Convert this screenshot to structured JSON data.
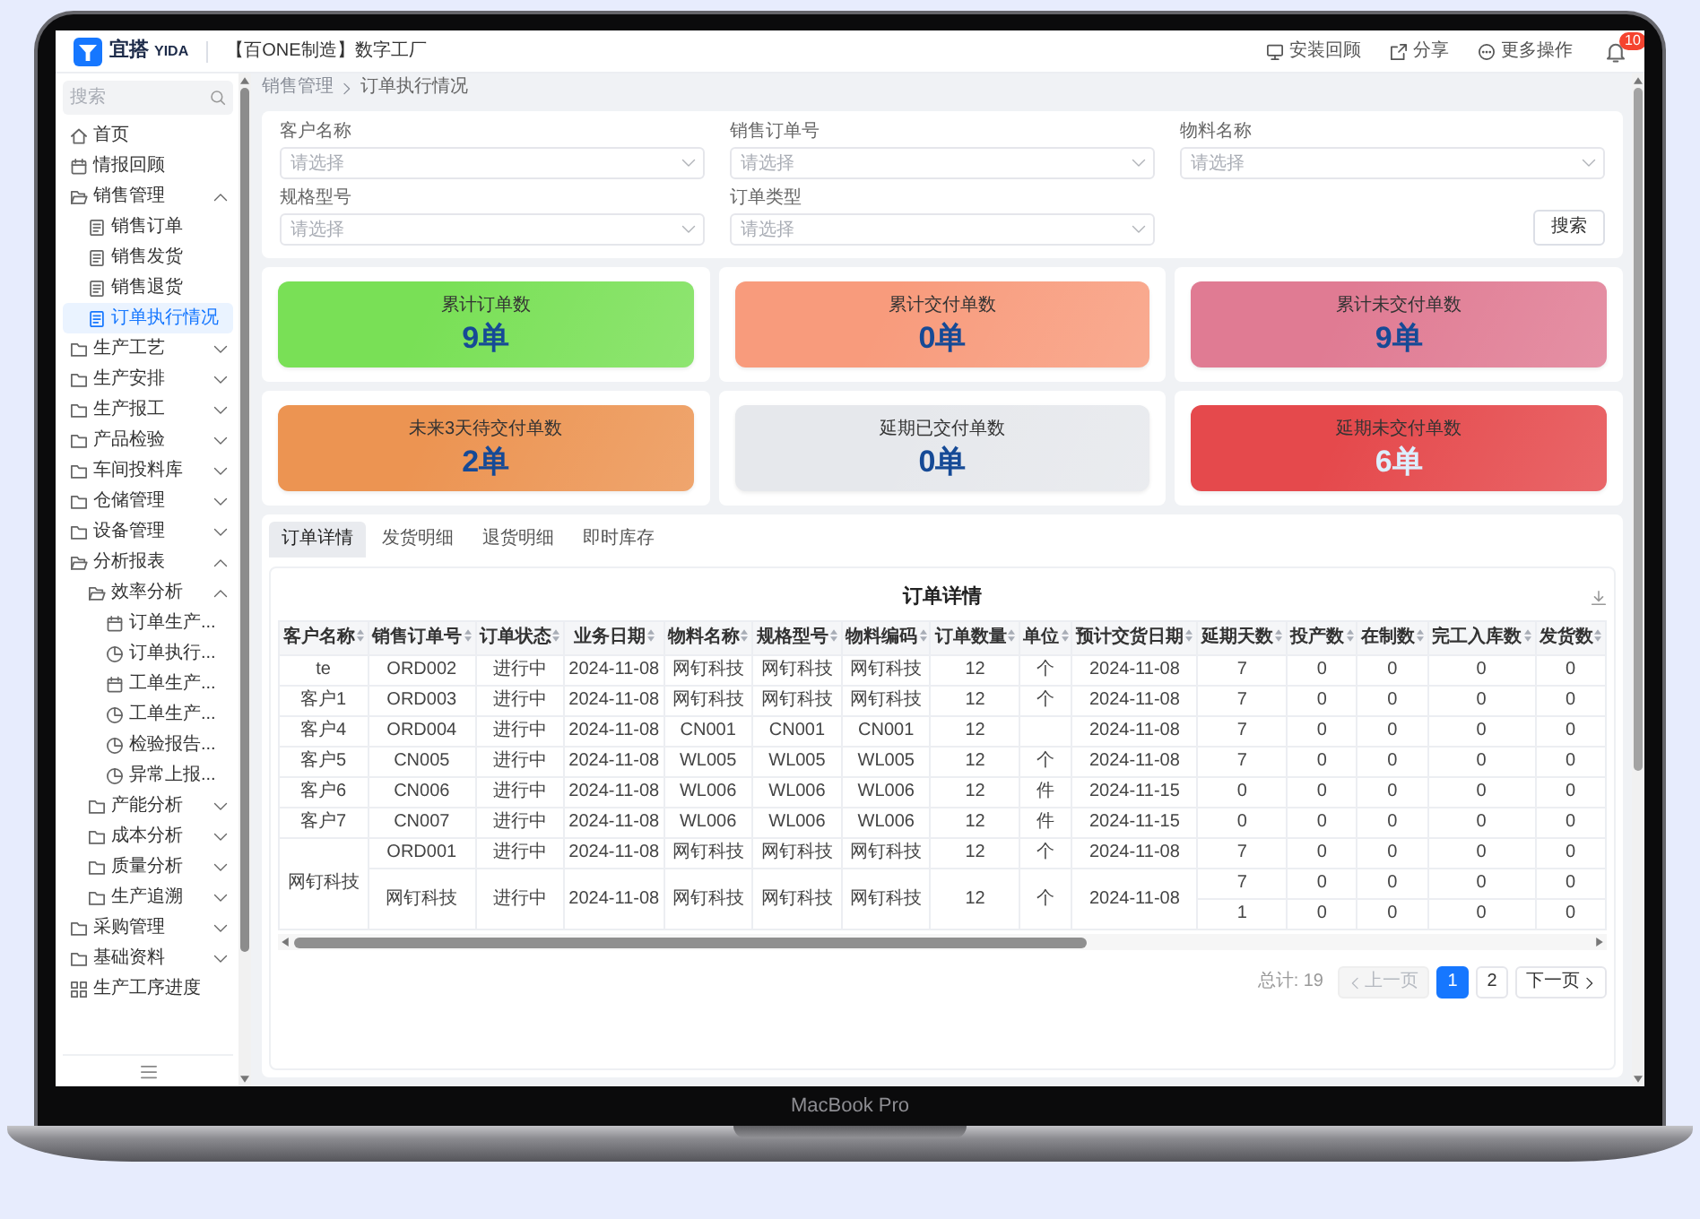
{
  "laptop": {
    "model_label": "MacBook Pro"
  },
  "header": {
    "logo_name": "宜搭",
    "logo_tag": "YIDA",
    "app_title": "【百ONE制造】数字工厂",
    "actions": [
      {
        "kind": "install",
        "label": "安装回顾"
      },
      {
        "kind": "share",
        "label": "分享"
      },
      {
        "kind": "more",
        "label": "更多操作"
      }
    ],
    "notification_badge": "10"
  },
  "sidebar": {
    "search": {
      "placeholder": "搜索"
    },
    "items": [
      {
        "kind": "home",
        "label": "首页",
        "selected": false
      },
      {
        "kind": "form",
        "label": "情报回顾",
        "selected": false
      },
      {
        "kind": "group",
        "label": "销售管理",
        "selected": false,
        "expanded": true,
        "children": [
          {
            "kind": "list",
            "label": "销售订单",
            "selected": false
          },
          {
            "kind": "list",
            "label": "销售发货",
            "selected": false
          },
          {
            "kind": "list",
            "label": "销售退货",
            "selected": false
          },
          {
            "kind": "list",
            "label": "订单执行情况",
            "selected": true
          }
        ]
      },
      {
        "kind": "group",
        "label": "生产工艺",
        "selected": false,
        "expanded": false
      },
      {
        "kind": "group",
        "label": "生产安排",
        "selected": false,
        "expanded": false
      },
      {
        "kind": "group",
        "label": "生产报工",
        "selected": false,
        "expanded": false
      },
      {
        "kind": "group",
        "label": "产品检验",
        "selected": false,
        "expanded": false
      },
      {
        "kind": "group",
        "label": "车间投料库",
        "selected": false,
        "expanded": false
      },
      {
        "kind": "group",
        "label": "仓储管理",
        "selected": false,
        "expanded": false
      },
      {
        "kind": "group",
        "label": "设备管理",
        "selected": false,
        "expanded": false
      },
      {
        "kind": "group",
        "label": "分析报表",
        "selected": false,
        "expanded": true,
        "children": [
          {
            "kind": "group",
            "label": "效率分析",
            "selected": false,
            "expanded": true,
            "children": [
              {
                "kind": "form",
                "label": "订单生产...",
                "selected": false
              },
              {
                "kind": "report",
                "label": "订单执行...",
                "selected": false
              },
              {
                "kind": "form",
                "label": "工单生产...",
                "selected": false
              },
              {
                "kind": "report",
                "label": "工单生产...",
                "selected": false
              },
              {
                "kind": "report",
                "label": "检验报告...",
                "selected": false
              },
              {
                "kind": "report",
                "label": "异常上报...",
                "selected": false
              }
            ]
          },
          {
            "kind": "group",
            "label": "产能分析",
            "selected": false,
            "expanded": false
          },
          {
            "kind": "group",
            "label": "成本分析",
            "selected": false,
            "expanded": false
          },
          {
            "kind": "group",
            "label": "质量分析",
            "selected": false,
            "expanded": false
          },
          {
            "kind": "group",
            "label": "生产追溯",
            "selected": false,
            "expanded": false
          }
        ]
      },
      {
        "kind": "group",
        "label": "采购管理",
        "selected": false,
        "expanded": false
      },
      {
        "kind": "group",
        "label": "基础资料",
        "selected": false,
        "expanded": false
      },
      {
        "kind": "dashboard",
        "label": "生产工序进度",
        "selected": false
      }
    ]
  },
  "breadcrumb": [
    "销售管理",
    "订单执行情况"
  ],
  "filters": {
    "fields": [
      {
        "label": "客户名称",
        "placeholder": "请选择"
      },
      {
        "label": "销售订单号",
        "placeholder": "请选择"
      },
      {
        "label": "物料名称",
        "placeholder": "请选择"
      },
      {
        "label": "规格型号",
        "placeholder": "请选择"
      },
      {
        "label": "订单类型",
        "placeholder": "请选择"
      }
    ],
    "search_button": "搜索"
  },
  "stats": [
    {
      "label": "累计订单数",
      "value": "9单",
      "color": "#79e056"
    },
    {
      "label": "累计交付单数",
      "value": "0单",
      "color": "#f89b7c"
    },
    {
      "label": "累计未交付单数",
      "value": "9单",
      "color": "#e07b93"
    },
    {
      "label": "未来3天待交付单数",
      "value": "2单",
      "color": "#ec9452"
    },
    {
      "label": "延期已交付单数",
      "value": "0单",
      "color": "#e6e8ec"
    },
    {
      "label": "延期未交付单数",
      "value": "6单",
      "color": "#e5494c"
    }
  ],
  "tabs": [
    {
      "label": "订单详情",
      "selected": true
    },
    {
      "label": "发货明细",
      "selected": false
    },
    {
      "label": "退货明细",
      "selected": false
    },
    {
      "label": "即时库存",
      "selected": false
    }
  ],
  "order_table": {
    "title": "订单详情",
    "columns": [
      "客户名称",
      "销售订单号",
      "订单状态",
      "业务日期",
      "物料名称",
      "规格型号",
      "物料编码",
      "订单数量",
      "单位",
      "预计交货日期",
      "延期天数",
      "投产数",
      "在制数",
      "完工入库数",
      "发货数"
    ],
    "groups": [
      {
        "customer": "te",
        "orders": [
          {
            "order_no": "ORD002",
            "status": "进行中",
            "business_date": "2024-11-08",
            "material_name": "网钉科技",
            "spec_model": "网钉科技",
            "material_code": "网钉科技",
            "quantity": "12",
            "unit": "个",
            "due_date": "2024-11-08",
            "lines": [
              {
                "delay_days": "7",
                "in_production": "0",
                "in_process": "0",
                "finished_stock": "0",
                "shipped": "0"
              }
            ]
          }
        ]
      },
      {
        "customer": "客户1",
        "orders": [
          {
            "order_no": "ORD003",
            "status": "进行中",
            "business_date": "2024-11-08",
            "material_name": "网钉科技",
            "spec_model": "网钉科技",
            "material_code": "网钉科技",
            "quantity": "12",
            "unit": "个",
            "due_date": "2024-11-08",
            "lines": [
              {
                "delay_days": "7",
                "in_production": "0",
                "in_process": "0",
                "finished_stock": "0",
                "shipped": "0"
              }
            ]
          }
        ]
      },
      {
        "customer": "客户4",
        "orders": [
          {
            "order_no": "ORD004",
            "status": "进行中",
            "business_date": "2024-11-08",
            "material_name": "CN001",
            "spec_model": "CN001",
            "material_code": "CN001",
            "quantity": "12",
            "due_date": "2024-11-08",
            "lines": [
              {
                "delay_days": "7",
                "in_production": "0",
                "in_process": "0",
                "finished_stock": "0",
                "shipped": "0"
              }
            ]
          }
        ]
      },
      {
        "customer": "客户5",
        "orders": [
          {
            "order_no": "CN005",
            "status": "进行中",
            "business_date": "2024-11-08",
            "material_name": "WL005",
            "spec_model": "WL005",
            "material_code": "WL005",
            "quantity": "12",
            "unit": "个",
            "due_date": "2024-11-08",
            "lines": [
              {
                "delay_days": "7",
                "in_production": "0",
                "in_process": "0",
                "finished_stock": "0",
                "shipped": "0"
              }
            ]
          }
        ]
      },
      {
        "customer": "客户6",
        "orders": [
          {
            "order_no": "CN006",
            "status": "进行中",
            "business_date": "2024-11-08",
            "material_name": "WL006",
            "spec_model": "WL006",
            "material_code": "WL006",
            "quantity": "12",
            "unit": "件",
            "due_date": "2024-11-15",
            "lines": [
              {
                "delay_days": "0",
                "in_production": "0",
                "in_process": "0",
                "finished_stock": "0",
                "shipped": "0"
              }
            ]
          }
        ]
      },
      {
        "customer": "客户7",
        "orders": [
          {
            "order_no": "CN007",
            "status": "进行中",
            "business_date": "2024-11-08",
            "material_name": "WL006",
            "spec_model": "WL006",
            "material_code": "WL006",
            "quantity": "12",
            "unit": "件",
            "due_date": "2024-11-15",
            "lines": [
              {
                "delay_days": "0",
                "in_production": "0",
                "in_process": "0",
                "finished_stock": "0",
                "shipped": "0"
              }
            ]
          }
        ]
      },
      {
        "customer": "网钉科技",
        "orders": [
          {
            "order_no": "ORD001",
            "status": "进行中",
            "business_date": "2024-11-08",
            "material_name": "网钉科技",
            "spec_model": "网钉科技",
            "material_code": "网钉科技",
            "quantity": "12",
            "unit": "个",
            "due_date": "2024-11-08",
            "lines": [
              {
                "delay_days": "7",
                "in_production": "0",
                "in_process": "0",
                "finished_stock": "0",
                "shipped": "0"
              }
            ]
          },
          {
            "order_no": "网钉科技",
            "status": "进行中",
            "business_date": "2024-11-08",
            "material_name": "网钉科技",
            "spec_model": "网钉科技",
            "material_code": "网钉科技",
            "quantity": "12",
            "unit": "个",
            "due_date": "2024-11-08",
            "lines": [
              {
                "delay_days": "7",
                "in_production": "0",
                "in_process": "0",
                "finished_stock": "0",
                "shipped": "0"
              },
              {
                "delay_days": "1",
                "in_production": "0",
                "in_process": "0",
                "finished_stock": "0",
                "shipped": "0"
              }
            ]
          }
        ]
      }
    ]
  },
  "pagination": {
    "total": "总计: 19",
    "prev": {
      "label": "上一页",
      "disabled": true
    },
    "pages": [
      {
        "label": "1",
        "selected": true
      },
      {
        "label": "2",
        "selected": false
      }
    ],
    "next": {
      "label": "下一页",
      "disabled": false
    }
  }
}
